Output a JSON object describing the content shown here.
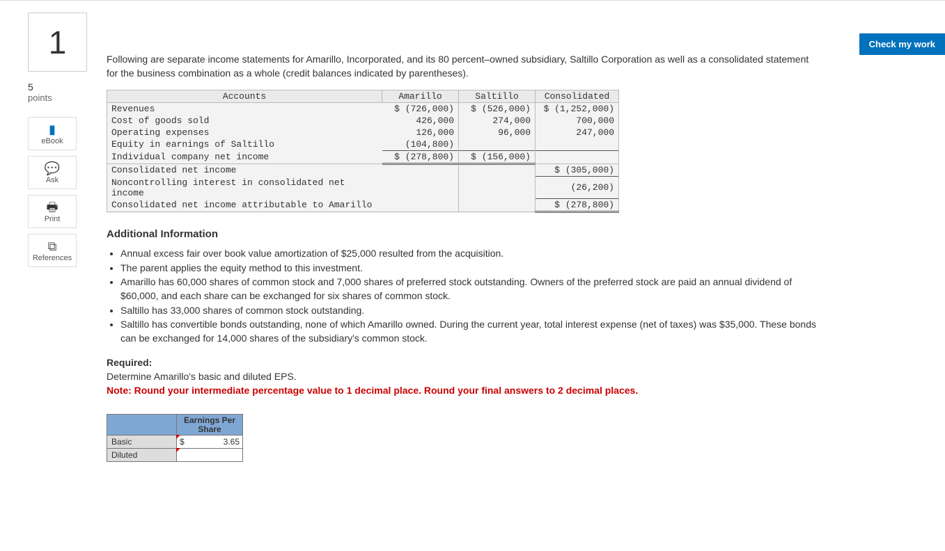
{
  "check_button": "Check my work",
  "question_number": "1",
  "points_value": "5",
  "points_label": "points",
  "tools": {
    "ebook": "eBook",
    "ask": "Ask",
    "print": "Print",
    "references": "References"
  },
  "intro_text": "Following are separate income statements for Amarillo, Incorporated, and its 80 percent–owned subsidiary, Saltillo Corporation as well as a consolidated statement for the business combination as a whole (credit balances indicated by parentheses).",
  "stmt_headers": {
    "c1": "Accounts",
    "c2": "Amarillo",
    "c3": "Saltillo",
    "c4": "Consolidated"
  },
  "stmt_rows": [
    {
      "acct": "Revenues",
      "a": "$ (726,000)",
      "s": "$ (526,000)",
      "c": "$ (1,252,000)"
    },
    {
      "acct": "Cost of goods sold",
      "a": "426,000",
      "s": "274,000",
      "c": "700,000"
    },
    {
      "acct": "Operating expenses",
      "a": "126,000",
      "s": "96,000",
      "c": "247,000"
    },
    {
      "acct": "Equity in earnings of Saltillo",
      "a": "(104,800)",
      "s": "",
      "c": ""
    },
    {
      "acct": "Individual company net income",
      "a": "$ (278,800)",
      "s": "$ (156,000)",
      "c": ""
    },
    {
      "acct": "Consolidated net income",
      "a": "",
      "s": "",
      "c": "$ (305,000)"
    },
    {
      "acct": "Noncontrolling interest in consolidated net income",
      "a": "",
      "s": "",
      "c": "(26,200)"
    },
    {
      "acct": "Consolidated net income attributable to Amarillo",
      "a": "",
      "s": "",
      "c": "$ (278,800)"
    }
  ],
  "additional_title": "Additional Information",
  "bullets": [
    "Annual excess fair over book value amortization of $25,000 resulted from the acquisition.",
    "The parent applies the equity method to this investment.",
    "Amarillo has 60,000 shares of common stock and 7,000 shares of preferred stock outstanding. Owners of the preferred stock are paid an annual dividend of $60,000, and each share can be exchanged for six shares of common stock.",
    "Saltillo has 33,000 shares of common stock outstanding.",
    "Saltillo has convertible bonds outstanding, none of which Amarillo owned. During the current year, total interest expense (net of taxes) was $35,000. These bonds can be exchanged for 14,000 shares of the subsidiary's common stock."
  ],
  "required_label": "Required:",
  "required_text": "Determine Amarillo's basic and diluted EPS.",
  "note_text": "Note: Round your intermediate percentage value to 1 decimal place. Round your final answers to 2 decimal places.",
  "answer_header": "Earnings Per Share",
  "answer_rows": {
    "basic": {
      "label": "Basic",
      "currency": "$",
      "value": "3.65"
    },
    "diluted": {
      "label": "Diluted",
      "currency": "",
      "value": ""
    }
  }
}
